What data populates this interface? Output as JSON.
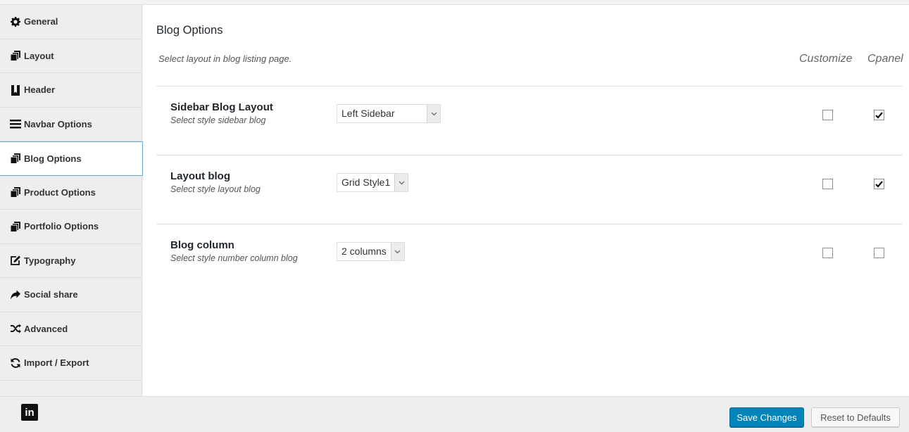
{
  "sidebar": {
    "items": [
      {
        "label": "General",
        "icon": "gear-icon",
        "active": false
      },
      {
        "label": "Layout",
        "icon": "copy-icon",
        "active": false
      },
      {
        "label": "Header",
        "icon": "bookmark-icon",
        "active": false
      },
      {
        "label": "Navbar Options",
        "icon": "bars-icon",
        "active": false
      },
      {
        "label": "Blog Options",
        "icon": "copy-icon",
        "active": true
      },
      {
        "label": "Product Options",
        "icon": "copy-icon",
        "active": false
      },
      {
        "label": "Portfolio Options",
        "icon": "copy-icon",
        "active": false
      },
      {
        "label": "Typography",
        "icon": "edit-icon",
        "active": false
      },
      {
        "label": "Social share",
        "icon": "share-icon",
        "active": false
      },
      {
        "label": "Advanced",
        "icon": "random-icon",
        "active": false
      },
      {
        "label": "Import / Export",
        "icon": "refresh-icon",
        "active": false
      }
    ]
  },
  "main": {
    "title": "Blog Options",
    "description": "Select layout in blog listing page.",
    "columns": {
      "customize": "Customize",
      "cpanel": "Cpanel"
    },
    "options": [
      {
        "title": "Sidebar Blog Layout",
        "subtitle": "Select style sidebar blog",
        "value": "Left Sidebar",
        "customize": false,
        "cpanel": true
      },
      {
        "title": "Layout blog",
        "subtitle": "Select style layout blog",
        "value": "Grid Style1",
        "customize": false,
        "cpanel": true
      },
      {
        "title": "Blog column",
        "subtitle": "Select style number column blog",
        "value": "2 columns",
        "customize": false,
        "cpanel": false
      }
    ]
  },
  "footer": {
    "social_icon": "linkedin-icon",
    "social_label": "in",
    "save_label": "Save Changes",
    "reset_label": "Reset to Defaults"
  },
  "colors": {
    "accent": "#0085ba",
    "active_border": "#66a8d6"
  }
}
